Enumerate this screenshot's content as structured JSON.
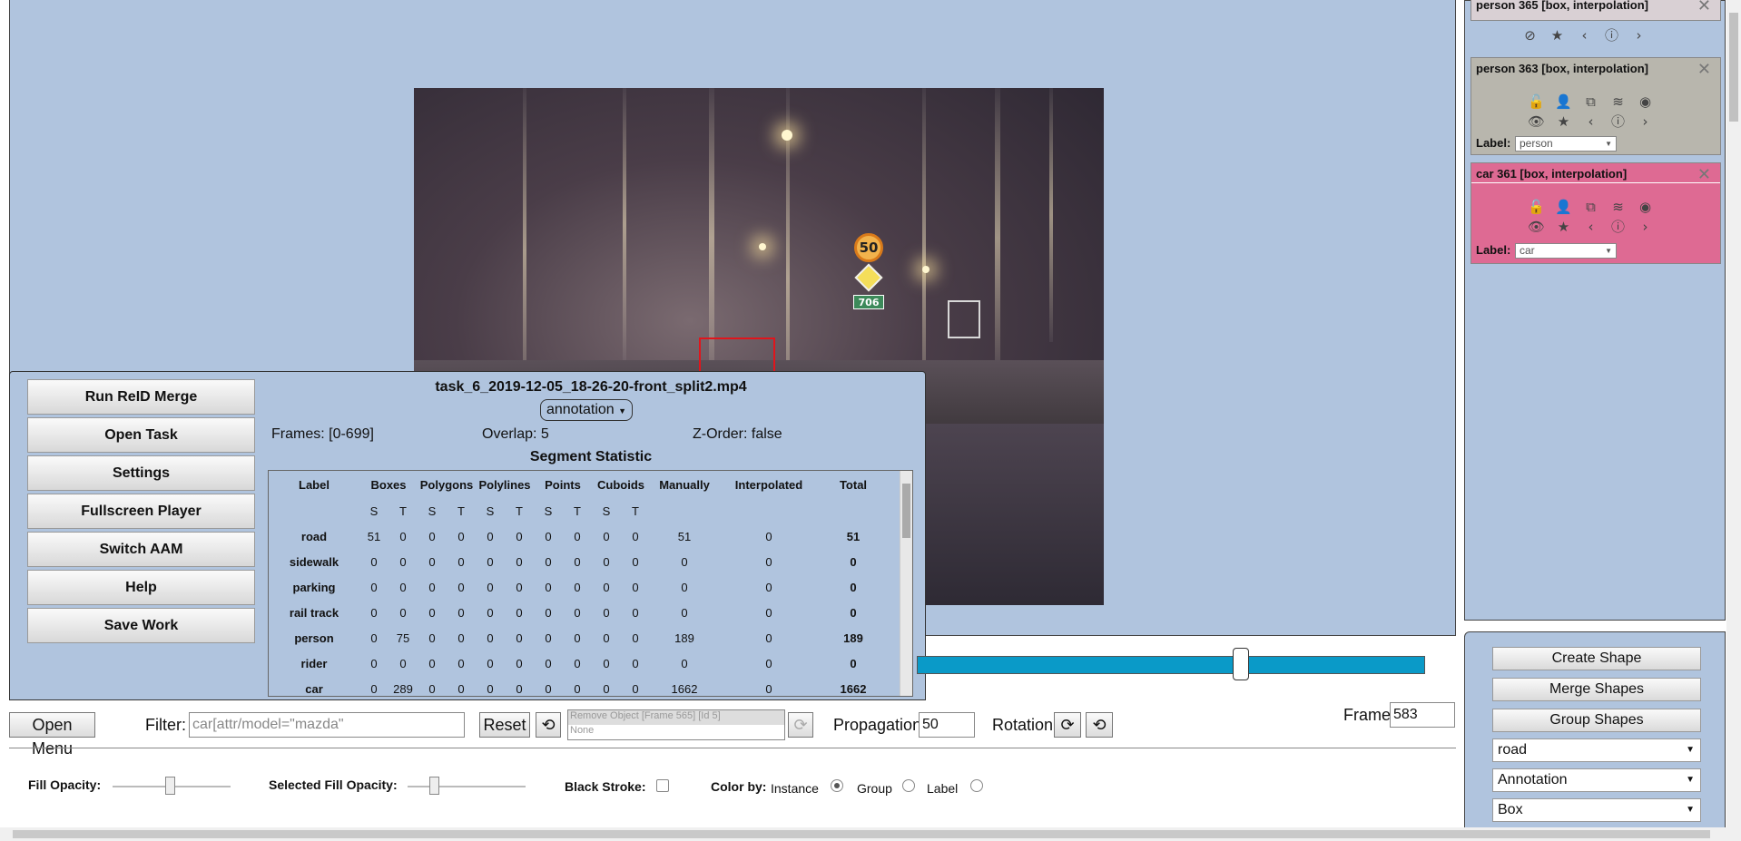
{
  "task": {
    "name": "task_6_2019-12-05_18-26-20-front_split2.mp4",
    "mode": "annotation",
    "frames": "Frames: [0-699]",
    "overlap": "Overlap: 5",
    "zorder": "Z-Order: false",
    "segment_title": "Segment Statistic"
  },
  "menu": {
    "items": [
      "Run ReID Merge",
      "Open Task",
      "Settings",
      "Fullscreen Player",
      "Switch AAM",
      "Help",
      "Save Work"
    ]
  },
  "stats": {
    "headers": [
      "Label",
      "Boxes",
      "Polygons",
      "Polylines",
      "Points",
      "Cuboids",
      "Manually",
      "Interpolated",
      "Total"
    ],
    "subheaders": [
      "S",
      "T",
      "S",
      "T",
      "S",
      "T",
      "S",
      "T",
      "S",
      "T"
    ],
    "rows": [
      [
        "road",
        "51",
        "0",
        "0",
        "0",
        "0",
        "0",
        "0",
        "0",
        "0",
        "0",
        "51",
        "0",
        "51"
      ],
      [
        "sidewalk",
        "0",
        "0",
        "0",
        "0",
        "0",
        "0",
        "0",
        "0",
        "0",
        "0",
        "0",
        "0",
        "0"
      ],
      [
        "parking",
        "0",
        "0",
        "0",
        "0",
        "0",
        "0",
        "0",
        "0",
        "0",
        "0",
        "0",
        "0",
        "0"
      ],
      [
        "rail track",
        "0",
        "0",
        "0",
        "0",
        "0",
        "0",
        "0",
        "0",
        "0",
        "0",
        "0",
        "0",
        "0"
      ],
      [
        "person",
        "0",
        "75",
        "0",
        "0",
        "0",
        "0",
        "0",
        "0",
        "0",
        "0",
        "189",
        "0",
        "189"
      ],
      [
        "rider",
        "0",
        "0",
        "0",
        "0",
        "0",
        "0",
        "0",
        "0",
        "0",
        "0",
        "0",
        "0",
        "0"
      ],
      [
        "car",
        "0",
        "289",
        "0",
        "0",
        "0",
        "0",
        "0",
        "0",
        "0",
        "0",
        "1662",
        "0",
        "1662"
      ]
    ]
  },
  "image": {
    "sign_speed": "50",
    "sign_route": "706"
  },
  "objects": [
    {
      "title": "person 365 [box, interpolation]",
      "color": "#d9d0d4"
    },
    {
      "title": "person 363 [box, interpolation]",
      "label_caption": "Label:",
      "label_value": "person",
      "color": "#b8b6ad"
    },
    {
      "title": "car 361 [box, interpolation]",
      "label_caption": "Label:",
      "label_value": "car",
      "color": "#de6a93"
    }
  ],
  "controls": {
    "create": "Create Shape",
    "merge": "Merge Shapes",
    "group": "Group Shapes",
    "label_select": "road",
    "mode_select": "Annotation",
    "shape_select": "Box"
  },
  "toolbar": {
    "open_menu": "Open Menu",
    "filter_label": "Filter:",
    "filter_value": "car[attr/model=\"mazda\"",
    "reset": "Reset",
    "history_top": "Remove Object [Frame 565] [Id 5]",
    "history_bottom": "None",
    "propagation_label": "Propagation",
    "propagation_value": "50",
    "rotation_label": "Rotation",
    "frame_label": "Frame",
    "frame_value": "583"
  },
  "settings": {
    "fill_opacity": "Fill Opacity:",
    "selected_fill_opacity": "Selected Fill Opacity:",
    "black_stroke": "Black Stroke:",
    "color_by": "Color by:",
    "instance": "Instance",
    "group": "Group",
    "label": "Label"
  },
  "colors": {
    "canvas_bg": "#b0c4de",
    "slider": "#0a9ac8",
    "car_box": "#e0151c",
    "car_card": "#de6a93"
  }
}
